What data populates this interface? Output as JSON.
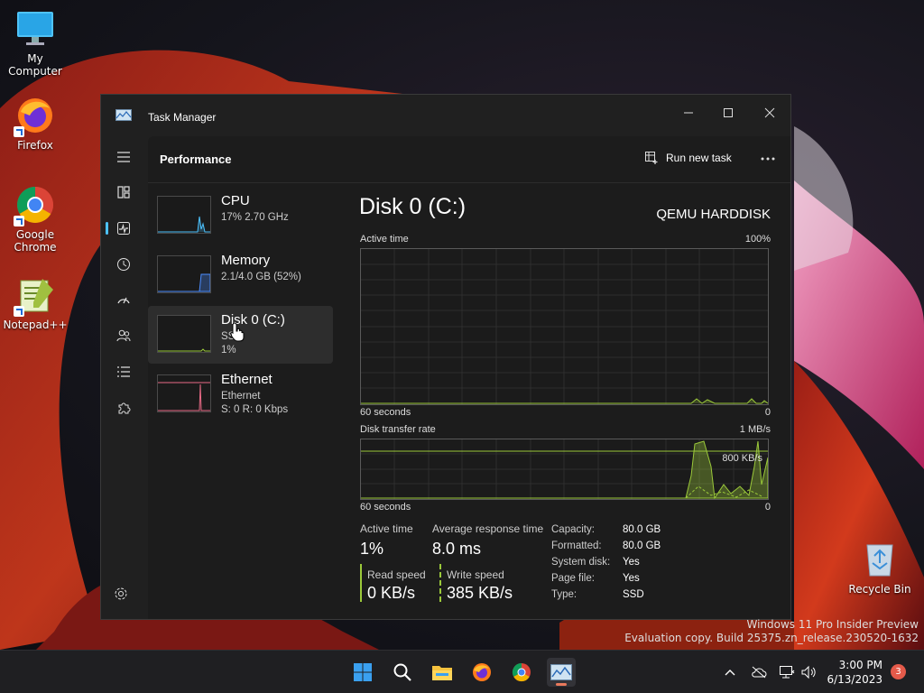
{
  "desktop": {
    "icons": [
      {
        "label": "My Computer",
        "icon": "monitor-icon"
      },
      {
        "label": "Firefox",
        "icon": "firefox-icon"
      },
      {
        "label": "Google Chrome",
        "icon": "chrome-icon"
      },
      {
        "label": "Notepad++",
        "icon": "notepadpp-icon"
      },
      {
        "label": "Recycle Bin",
        "icon": "recycle-bin-icon"
      }
    ]
  },
  "window": {
    "title": "Task Manager",
    "header": {
      "title": "Performance",
      "run_task_label": "Run new task"
    }
  },
  "devices": [
    {
      "name": "CPU",
      "line1": "17%  2.70 GHz",
      "line2": "",
      "color": "#4cc2ff"
    },
    {
      "name": "Memory",
      "line1": "2.1/4.0 GB (52%)",
      "line2": "",
      "color": "#4c8dff"
    },
    {
      "name": "Disk 0 (C:)",
      "line1": "SSD",
      "line2": "1%",
      "color": "#9bc93a"
    },
    {
      "name": "Ethernet",
      "line1": "Ethernet",
      "line2": "S: 0  R: 0 Kbps",
      "color": "#e86a86"
    }
  ],
  "detail": {
    "title": "Disk 0 (C:)",
    "model": "QEMU HARDDISK",
    "active_graph": {
      "label": "Active time",
      "max": "100%",
      "xlabel": "60 seconds",
      "min": "0"
    },
    "transfer_graph": {
      "label": "Disk transfer rate",
      "max": "1 MB/s",
      "xlabel": "60 seconds",
      "min": "0",
      "annotation": "800 KB/s"
    },
    "stats": {
      "active_time_label": "Active time",
      "active_time": "1%",
      "avg_response_label": "Average response time",
      "avg_response": "8.0 ms",
      "read_label": "Read speed",
      "read": "0 KB/s",
      "write_label": "Write speed",
      "write": "385 KB/s"
    },
    "props": [
      {
        "key": "Capacity:",
        "value": "80.0 GB"
      },
      {
        "key": "Formatted:",
        "value": "80.0 GB"
      },
      {
        "key": "System disk:",
        "value": "Yes"
      },
      {
        "key": "Page file:",
        "value": "Yes"
      },
      {
        "key": "Type:",
        "value": "SSD"
      }
    ]
  },
  "watermark": {
    "line1": "Windows 11 Pro Insider Preview",
    "line2": "Evaluation copy. Build 25375.zn_release.230520-1632"
  },
  "taskbar": {
    "time": "3:00 PM",
    "date": "6/13/2023",
    "notifications": "3"
  }
}
